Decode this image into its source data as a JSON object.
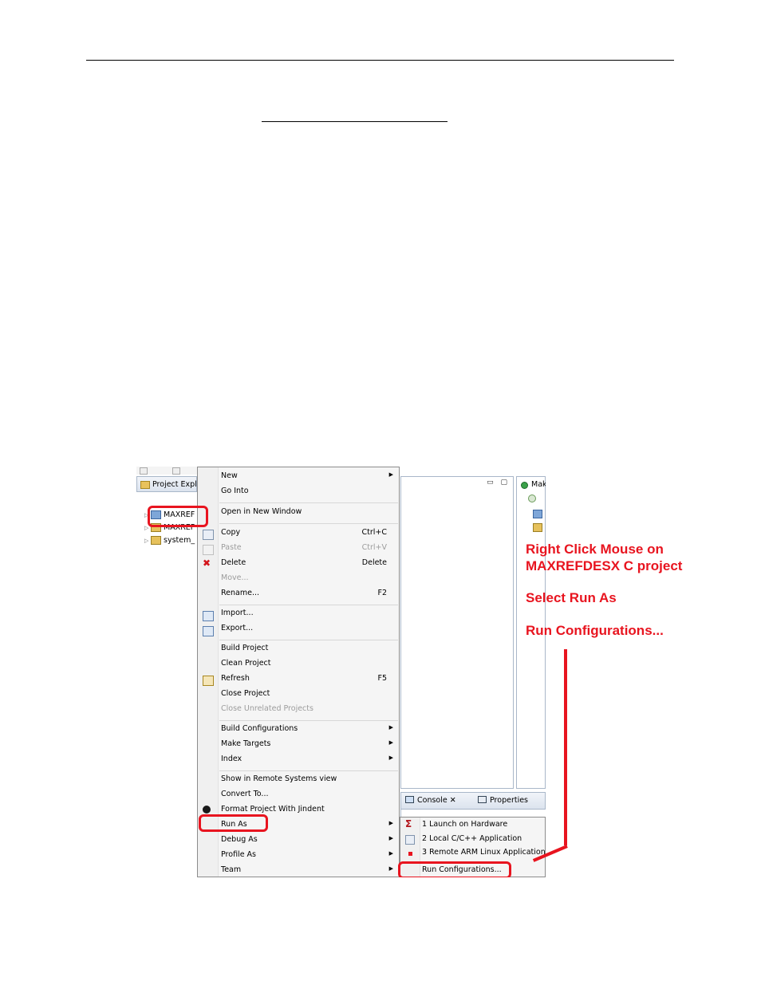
{
  "explorer": {
    "tab_label": "Project Explo",
    "tree": [
      {
        "label": "MAXREF",
        "icon": "c-project-folder-icon"
      },
      {
        "label": "MAXREF",
        "icon": "project-folder-icon"
      },
      {
        "label": "system_",
        "icon": "hw-platform-folder-icon"
      }
    ]
  },
  "make_panel": {
    "label": "Mak"
  },
  "bottom_tabs": {
    "console": "Console",
    "properties": "Properties"
  },
  "context_menu": {
    "items": [
      {
        "label": "New",
        "submenu": true
      },
      {
        "label": "Go Into"
      },
      {
        "label": "Open in New Window"
      },
      {
        "label": "Copy",
        "shortcut": "Ctrl+C"
      },
      {
        "label": "Paste",
        "shortcut": "Ctrl+V",
        "disabled": true
      },
      {
        "label": "Delete",
        "shortcut": "Delete"
      },
      {
        "label": "Move...",
        "disabled": true
      },
      {
        "label": "Rename...",
        "shortcut": "F2"
      },
      {
        "label": "Import..."
      },
      {
        "label": "Export..."
      },
      {
        "label": "Build Project"
      },
      {
        "label": "Clean Project"
      },
      {
        "label": "Refresh",
        "shortcut": "F5"
      },
      {
        "label": "Close Project"
      },
      {
        "label": "Close Unrelated Projects",
        "disabled": true
      },
      {
        "label": "Build Configurations",
        "submenu": true
      },
      {
        "label": "Make Targets",
        "submenu": true
      },
      {
        "label": "Index",
        "submenu": true
      },
      {
        "label": "Show in Remote Systems view"
      },
      {
        "label": "Convert To..."
      },
      {
        "label": "Format Project With Jindent"
      },
      {
        "label": "Run As",
        "submenu": true
      },
      {
        "label": "Debug As",
        "submenu": true
      },
      {
        "label": "Profile As",
        "submenu": true
      },
      {
        "label": "Team",
        "submenu": true
      }
    ],
    "submenu_arrow": "▶"
  },
  "run_as_submenu": {
    "items": [
      {
        "label": "1 Launch on Hardware"
      },
      {
        "label": "2 Local C/C++ Application"
      },
      {
        "label": "3 Remote ARM Linux Application"
      },
      {
        "label": "Run Configurations..."
      }
    ]
  },
  "annotation": {
    "line1": "Right Click Mouse on",
    "line2": "MAXREFDESX C project",
    "line3": "Select Run As",
    "line4": "Run Configurations...",
    "color": "#e8141f"
  }
}
